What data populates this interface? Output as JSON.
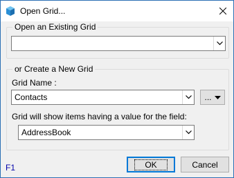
{
  "window": {
    "title": "Open Grid..."
  },
  "existing_group": {
    "title": "Open an Existing Grid",
    "grid_value": ""
  },
  "new_group": {
    "title": "or Create a New Grid",
    "grid_name_label": "Grid Name :",
    "grid_name_value": "Contacts",
    "more_button_label": "...",
    "field_label": "Grid will show items having a value for the field:",
    "field_value": "AddressBook"
  },
  "buttons": {
    "ok_label": "OK",
    "cancel_label": "Cancel"
  },
  "help": {
    "f1_label": "F1"
  },
  "colors": {
    "accent": "#0078d7",
    "help_text": "#0000aa"
  },
  "icons": [
    "app-icon",
    "close-icon",
    "chevron-down-icon",
    "dropdown-arrow-icon"
  ]
}
